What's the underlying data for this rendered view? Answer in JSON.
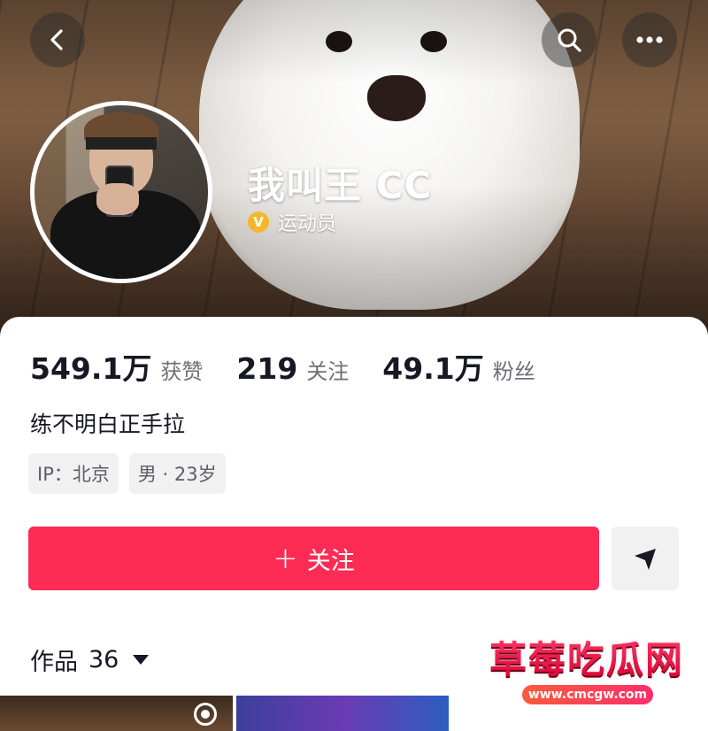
{
  "profile": {
    "name": "我叫王 CC",
    "verified_label": "运动员",
    "verified_icon_glyph": "V",
    "bio": "练不明白正手拉",
    "tags": [
      "IP：北京",
      "男 · 23岁"
    ]
  },
  "stats": [
    {
      "value": "549.1万",
      "label": "获赞"
    },
    {
      "value": "219",
      "label": "关注"
    },
    {
      "value": "49.1万",
      "label": "粉丝"
    }
  ],
  "actions": {
    "follow_plus": "+",
    "follow_label": "关注"
  },
  "works": {
    "label": "作品",
    "count": "36"
  },
  "watermark": {
    "title": "草莓吃瓜网",
    "url": "www.cmcgw.com"
  },
  "icons": {
    "back": "chevron-left-icon",
    "search": "search-icon",
    "more": "more-horizontal-icon",
    "message": "send-icon",
    "live": "live-ring-icon"
  },
  "colors": {
    "follow_button": "#fe2c55",
    "verified_badge": "#f3b72d",
    "text_primary": "#161823",
    "text_secondary": "#6e6f77",
    "tag_bg": "#f1f1f2"
  }
}
